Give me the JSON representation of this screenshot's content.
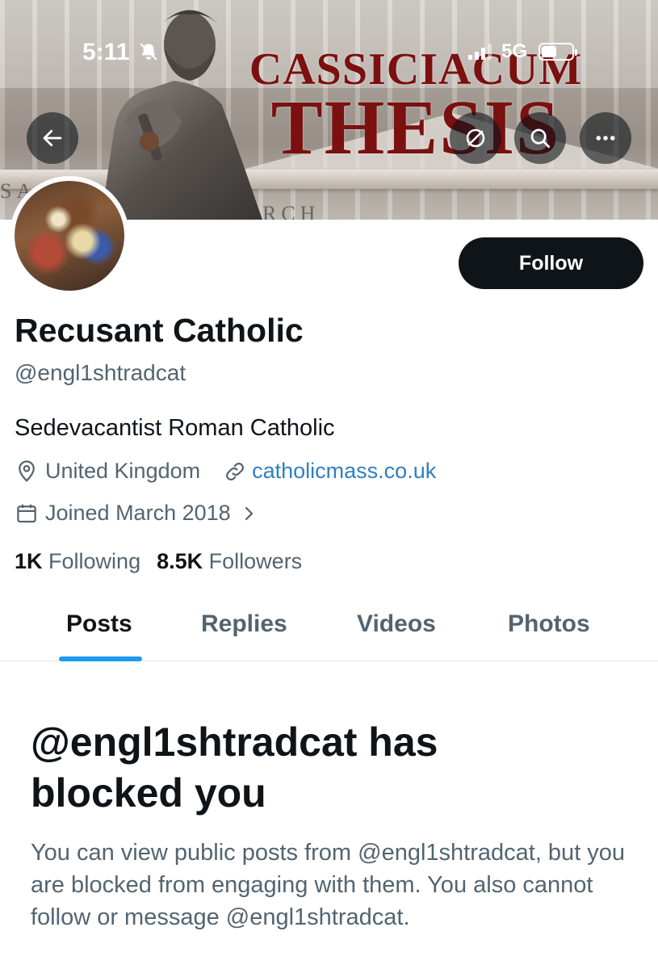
{
  "status_bar": {
    "time": "5:11",
    "network": "5G",
    "mute_icon": "bell-slash-icon"
  },
  "banner": {
    "title_line1": "CASSICIACUM",
    "title_line2": "THESIS",
    "inscription_left": "SA",
    "inscription_right": "RCH",
    "title_color": "#7b1010"
  },
  "header_buttons": {
    "back_icon": "arrow-left-icon",
    "mute_icon": "mute-icon",
    "search_icon": "search-icon",
    "more_icon": "more-icon"
  },
  "profile": {
    "display_name": "Recusant Catholic",
    "handle": "@engl1shtradcat",
    "bio": "Sedevacantist Roman Catholic",
    "location": "United Kingdom",
    "website": "catholicmass.co.uk",
    "joined": "Joined March 2018",
    "following_count": "1K",
    "following_label": "Following",
    "followers_count": "8.5K",
    "followers_label": "Followers",
    "follow_button": "Follow"
  },
  "tabs": [
    {
      "label": "Posts",
      "active": true
    },
    {
      "label": "Replies",
      "active": false
    },
    {
      "label": "Videos",
      "active": false
    },
    {
      "label": "Photos",
      "active": false
    }
  ],
  "blocked": {
    "title": "@engl1shtradcat has blocked you",
    "body": "You can view public posts from @engl1shtradcat, but you are blocked from engaging with them. You also cannot follow or message @engl1shtradcat."
  },
  "colors": {
    "accent": "#1d9bf0",
    "link": "#2f7fc2",
    "text_primary": "#0f1419",
    "text_secondary": "#536471"
  }
}
